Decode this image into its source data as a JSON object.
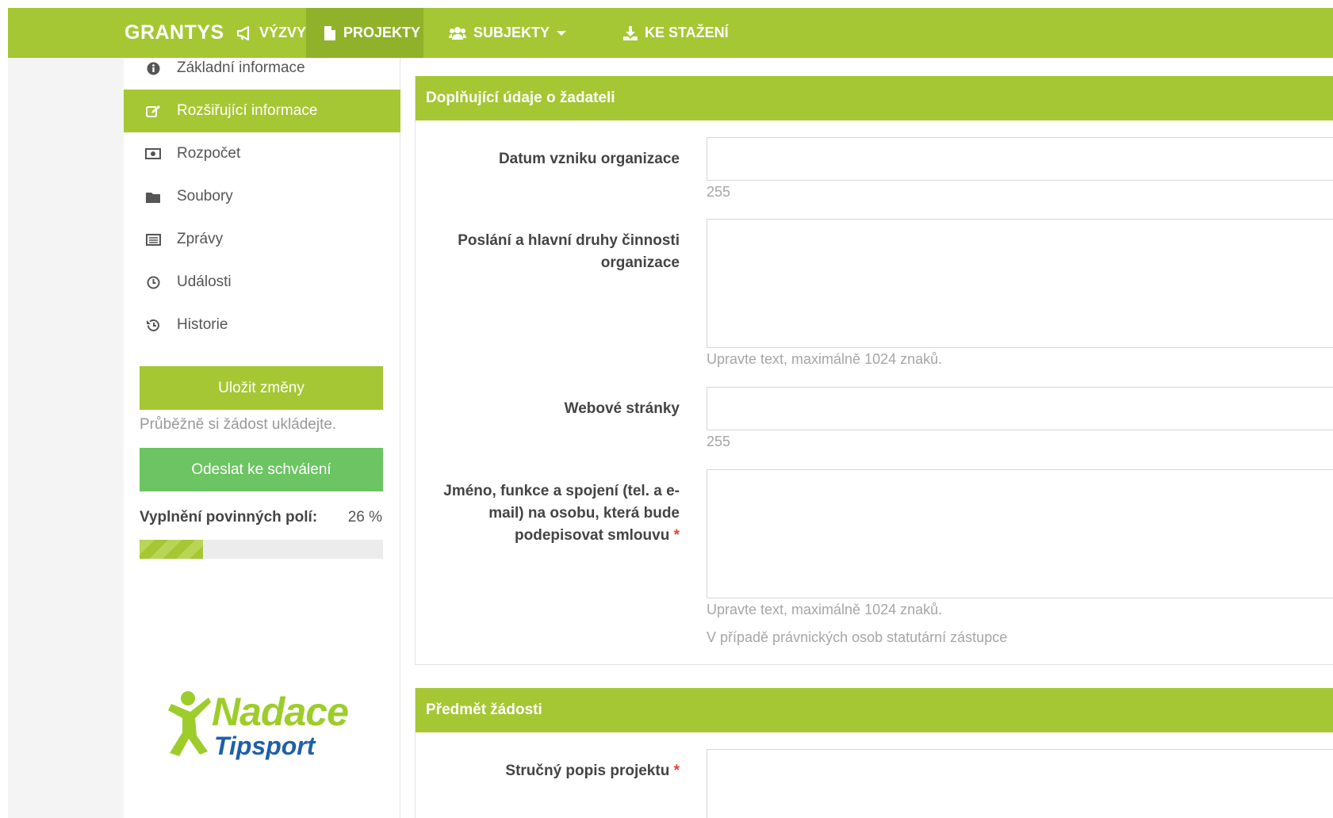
{
  "navbar": {
    "brand": "GRANTYS",
    "items": [
      {
        "label": "VÝZVY",
        "icon": "megaphone-icon"
      },
      {
        "label": "PROJEKTY",
        "icon": "file-icon",
        "active": true
      },
      {
        "label": "SUBJEKTY",
        "icon": "users-icon",
        "dropdown": true
      },
      {
        "label": "KE STAŽENÍ",
        "icon": "download-icon"
      }
    ]
  },
  "sidebar": {
    "items": [
      {
        "label": "Základní informace",
        "icon": "info-circle-icon"
      },
      {
        "label": "Rozšiřující informace",
        "icon": "edit-icon",
        "active": true
      },
      {
        "label": "Rozpočet",
        "icon": "money-icon"
      },
      {
        "label": "Soubory",
        "icon": "folder-icon"
      },
      {
        "label": "Zprávy",
        "icon": "list-icon"
      },
      {
        "label": "Události",
        "icon": "clock-icon"
      },
      {
        "label": "Historie",
        "icon": "history-icon"
      }
    ],
    "save_label": "Uložit změny",
    "save_hint": "Průběžně si žádost ukládejte.",
    "send_label": "Odeslat ke schválení",
    "progress_label": "Vyplnění povinných polí:",
    "progress_text": "26 %",
    "progress_value": 0.26,
    "logo": {
      "line1": "Nadace",
      "line2": "Tipsport"
    }
  },
  "section1": {
    "title": "Doplňující údaje o žadateli",
    "fields": [
      {
        "label": "Datum vzniku organizace",
        "help": "255"
      },
      {
        "label": "Poslání a hlavní druhy činnosti organizace",
        "help": "Upravte text, maximálně 1024 znaků."
      },
      {
        "label": "Webové stránky",
        "help": "255"
      },
      {
        "label": "Jméno, funkce a spojení (tel. a e-mail) na osobu, která bude podepisovat smlouvu",
        "required": "*",
        "help": "Upravte text, maximálně 1024 znaků.",
        "help2": "V případě právnických osob statutární zástupce"
      }
    ]
  },
  "section2": {
    "title": "Předmět žádosti",
    "fields": [
      {
        "label": "Stručný popis projektu",
        "required": "*"
      }
    ]
  },
  "colors": {
    "primary": "#a5c734",
    "primary_dark": "#8fb22a",
    "success": "#6cc463",
    "required": "#e4433a"
  }
}
